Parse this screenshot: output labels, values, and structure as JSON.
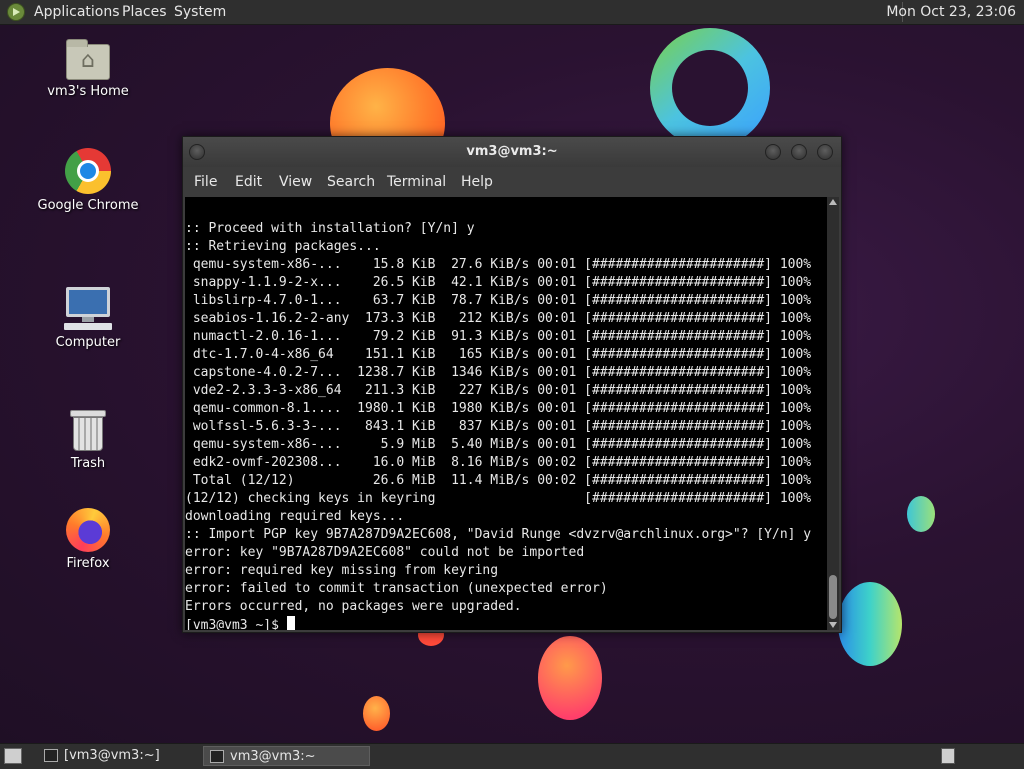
{
  "top_panel": {
    "menus": [
      "Applications",
      "Places",
      "System"
    ],
    "clock": "Mon Oct 23, 23:06"
  },
  "desktop_icons": [
    {
      "label": "vm3's Home",
      "icon": "home-folder-icon"
    },
    {
      "label": "Google Chrome",
      "icon": "chrome-icon"
    },
    {
      "label": "Computer",
      "icon": "computer-icon"
    },
    {
      "label": "Trash",
      "icon": "trash-icon"
    },
    {
      "label": "Firefox",
      "icon": "firefox-icon"
    }
  ],
  "terminal": {
    "title": "vm3@vm3:~",
    "menu": [
      "File",
      "Edit",
      "View",
      "Search",
      "Terminal",
      "Help"
    ],
    "lines": [
      ":: Proceed with installation? [Y/n] y",
      ":: Retrieving packages...",
      " qemu-system-x86-...    15.8 KiB  27.6 KiB/s 00:01 [######################] 100%",
      " snappy-1.1.9-2-x...    26.5 KiB  42.1 KiB/s 00:01 [######################] 100%",
      " libslirp-4.7.0-1...    63.7 KiB  78.7 KiB/s 00:01 [######################] 100%",
      " seabios-1.16.2-2-any  173.3 KiB   212 KiB/s 00:01 [######################] 100%",
      " numactl-2.0.16-1...    79.2 KiB  91.3 KiB/s 00:01 [######################] 100%",
      " dtc-1.7.0-4-x86_64    151.1 KiB   165 KiB/s 00:01 [######################] 100%",
      " capstone-4.0.2-7...  1238.7 KiB  1346 KiB/s 00:01 [######################] 100%",
      " vde2-2.3.3-3-x86_64   211.3 KiB   227 KiB/s 00:01 [######################] 100%",
      " qemu-common-8.1....  1980.1 KiB  1980 KiB/s 00:01 [######################] 100%",
      " wolfssl-5.6.3-3-...   843.1 KiB   837 KiB/s 00:01 [######################] 100%",
      " qemu-system-x86-...     5.9 MiB  5.40 MiB/s 00:01 [######################] 100%",
      " edk2-ovmf-202308...    16.0 MiB  8.16 MiB/s 00:02 [######################] 100%",
      " Total (12/12)          26.6 MiB  11.4 MiB/s 00:02 [######################] 100%",
      "(12/12) checking keys in keyring                   [######################] 100%",
      "downloading required keys...",
      ":: Import PGP key 9B7A287D9A2EC608, \"David Runge <dvzrv@archlinux.org>\"? [Y/n] y",
      "error: key \"9B7A287D9A2EC608\" could not be imported",
      "error: required key missing from keyring",
      "error: failed to commit transaction (unexpected error)",
      "Errors occurred, no packages were upgraded."
    ],
    "prompt": "[vm3@vm3 ~]$ "
  },
  "taskbar": {
    "tasks": [
      "[vm3@vm3:~]",
      "vm3@vm3:~"
    ]
  }
}
